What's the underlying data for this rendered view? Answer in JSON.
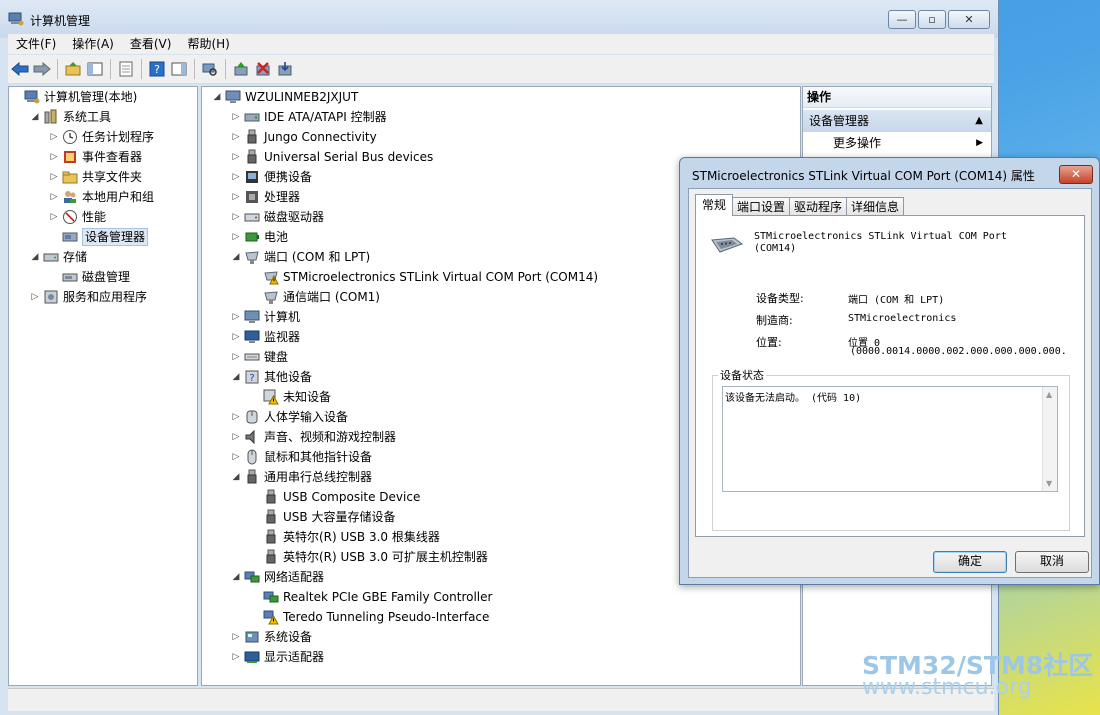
{
  "window": {
    "title": "计算机管理",
    "min_label": "—",
    "max_label": "▫",
    "close_label": "✕"
  },
  "menubar": [
    "文件(F)",
    "操作(A)",
    "查看(V)",
    "帮助(H)"
  ],
  "left_tree": [
    {
      "label": "计算机管理(本地)",
      "icon": "computer-management-icon",
      "indent": 0,
      "exp": ""
    },
    {
      "label": "系统工具",
      "icon": "system-tools-icon",
      "indent": 1,
      "exp": "◢"
    },
    {
      "label": "任务计划程序",
      "icon": "clock-icon",
      "indent": 2,
      "exp": "▷"
    },
    {
      "label": "事件查看器",
      "icon": "event-viewer-icon",
      "indent": 2,
      "exp": "▷"
    },
    {
      "label": "共享文件夹",
      "icon": "shared-folder-icon",
      "indent": 2,
      "exp": "▷"
    },
    {
      "label": "本地用户和组",
      "icon": "users-icon",
      "indent": 2,
      "exp": "▷"
    },
    {
      "label": "性能",
      "icon": "performance-icon",
      "indent": 2,
      "exp": "▷"
    },
    {
      "label": "设备管理器",
      "icon": "device-manager-icon",
      "indent": 2,
      "exp": "",
      "selected": true
    },
    {
      "label": "存储",
      "icon": "storage-icon",
      "indent": 1,
      "exp": "◢"
    },
    {
      "label": "磁盘管理",
      "icon": "disk-icon",
      "indent": 2,
      "exp": ""
    },
    {
      "label": "服务和应用程序",
      "icon": "services-icon",
      "indent": 1,
      "exp": "▷"
    }
  ],
  "device_tree": [
    {
      "label": "WZULINMEB2JXJUT",
      "icon": "computer-icon",
      "indent": 0,
      "exp": "◢"
    },
    {
      "label": "IDE ATA/ATAPI 控制器",
      "icon": "ide-controller-icon",
      "indent": 1,
      "exp": "▷"
    },
    {
      "label": "Jungo Connectivity",
      "icon": "usb-plug-icon",
      "indent": 1,
      "exp": "▷"
    },
    {
      "label": "Universal Serial Bus devices",
      "icon": "usb-plug-icon",
      "indent": 1,
      "exp": "▷"
    },
    {
      "label": "便携设备",
      "icon": "portable-device-icon",
      "indent": 1,
      "exp": "▷"
    },
    {
      "label": "处理器",
      "icon": "processor-icon",
      "indent": 1,
      "exp": "▷"
    },
    {
      "label": "磁盘驱动器",
      "icon": "disk-drive-icon",
      "indent": 1,
      "exp": "▷"
    },
    {
      "label": "电池",
      "icon": "battery-icon",
      "indent": 1,
      "exp": "▷"
    },
    {
      "label": "端口 (COM 和 LPT)",
      "icon": "port-icon",
      "indent": 1,
      "exp": "◢"
    },
    {
      "label": "STMicroelectronics STLink Virtual COM Port (COM14)",
      "icon": "port-warning-icon",
      "indent": 2,
      "exp": ""
    },
    {
      "label": "通信端口 (COM1)",
      "icon": "port-icon",
      "indent": 2,
      "exp": ""
    },
    {
      "label": "计算机",
      "icon": "computer-icon",
      "indent": 1,
      "exp": "▷"
    },
    {
      "label": "监视器",
      "icon": "monitor-icon",
      "indent": 1,
      "exp": "▷"
    },
    {
      "label": "键盘",
      "icon": "keyboard-icon",
      "indent": 1,
      "exp": "▷"
    },
    {
      "label": "其他设备",
      "icon": "unknown-device-icon",
      "indent": 1,
      "exp": "◢"
    },
    {
      "label": "未知设备",
      "icon": "unknown-warning-icon",
      "indent": 2,
      "exp": ""
    },
    {
      "label": "人体学输入设备",
      "icon": "hid-icon",
      "indent": 1,
      "exp": "▷"
    },
    {
      "label": "声音、视频和游戏控制器",
      "icon": "sound-icon",
      "indent": 1,
      "exp": "▷"
    },
    {
      "label": "鼠标和其他指针设备",
      "icon": "mouse-icon",
      "indent": 1,
      "exp": "▷"
    },
    {
      "label": "通用串行总线控制器",
      "icon": "usb-plug-icon",
      "indent": 1,
      "exp": "◢"
    },
    {
      "label": "USB Composite Device",
      "icon": "usb-plug-icon",
      "indent": 2,
      "exp": ""
    },
    {
      "label": "USB 大容量存储设备",
      "icon": "usb-plug-icon",
      "indent": 2,
      "exp": ""
    },
    {
      "label": "英特尔(R) USB 3.0 根集线器",
      "icon": "usb-plug-icon",
      "indent": 2,
      "exp": ""
    },
    {
      "label": "英特尔(R) USB 3.0 可扩展主机控制器",
      "icon": "usb-plug-icon",
      "indent": 2,
      "exp": ""
    },
    {
      "label": "网络适配器",
      "icon": "network-icon",
      "indent": 1,
      "exp": "◢"
    },
    {
      "label": "Realtek PCIe GBE Family Controller",
      "icon": "network-icon",
      "indent": 2,
      "exp": ""
    },
    {
      "label": "Teredo Tunneling Pseudo-Interface",
      "icon": "network-warning-icon",
      "indent": 2,
      "exp": ""
    },
    {
      "label": "系统设备",
      "icon": "system-device-icon",
      "indent": 1,
      "exp": "▷"
    },
    {
      "label": "显示适配器",
      "icon": "display-adapter-icon",
      "indent": 1,
      "exp": "▷"
    }
  ],
  "actions": {
    "header": "操作",
    "section": "设备管理器",
    "more": "更多操作"
  },
  "dialog": {
    "title": "STMicroelectronics STLink Virtual COM Port (COM14) 属性",
    "tabs": [
      "常规",
      "端口设置",
      "驱动程序",
      "详细信息"
    ],
    "device_name_line1": "STMicroelectronics STLink Virtual COM Port",
    "device_name_line2": "(COM14)",
    "type_label": "设备类型:",
    "type_value": "端口 (COM 和 LPT)",
    "mfr_label": "制造商:",
    "mfr_value": "STMicroelectronics",
    "loc_label": "位置:",
    "loc_value1": "位置 0",
    "loc_value2": "(0000.0014.0000.002.000.000.000.000.",
    "status_group": "设备状态",
    "status_text": "该设备无法启动。 (代码 10)",
    "ok": "确定",
    "cancel": "取消"
  },
  "watermark": {
    "line1": "STM32/STM8社区",
    "line2": "www.stmcu.org"
  },
  "colors": {
    "selection": "#dde8f5",
    "warning": "#f2c200",
    "accent": "#3c7fb1"
  }
}
